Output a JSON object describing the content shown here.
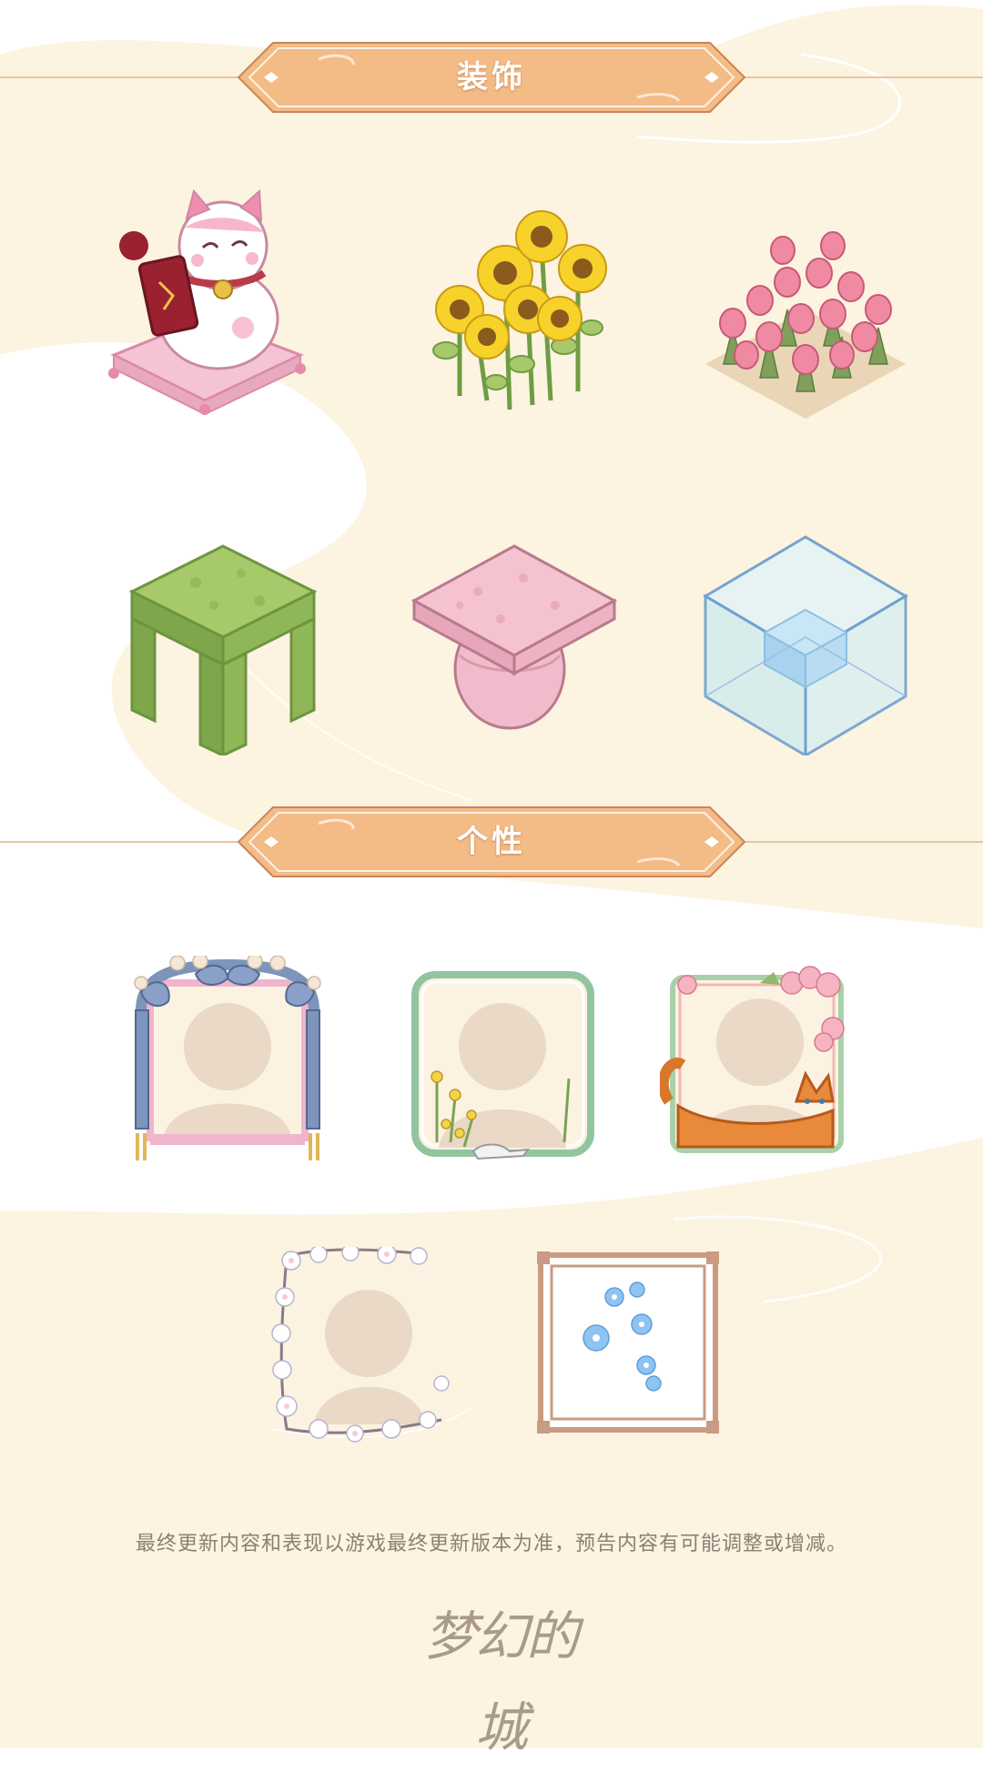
{
  "sections": {
    "decoration": {
      "title": "装饰"
    },
    "personality": {
      "title": "个性"
    }
  },
  "decoration_items": [
    "lucky-cat-on-cushion",
    "sunflower-cluster",
    "pink-tulip-bed",
    "green-grass-table",
    "pink-mushroom-stool",
    "glass-cube-display"
  ],
  "personality_items": [
    "blue-ornate-gate-avatar-frame",
    "green-flower-avatar-frame",
    "orange-cat-avatar-frame",
    "white-blossom-avatar-frame",
    "blue-flower-square-avatar-frame"
  ],
  "footer": {
    "notice": "最终更新内容和表现以游戏最终更新版本为准，预告内容有可能调整或增减。",
    "logo_text": "梦幻的城"
  },
  "colors": {
    "background_cream": "#fcf3e0",
    "banner_orange": "#f3bb86",
    "banner_border": "#c9855a",
    "notice_text": "#8c7f74",
    "logo_text": "#a89a8c"
  }
}
